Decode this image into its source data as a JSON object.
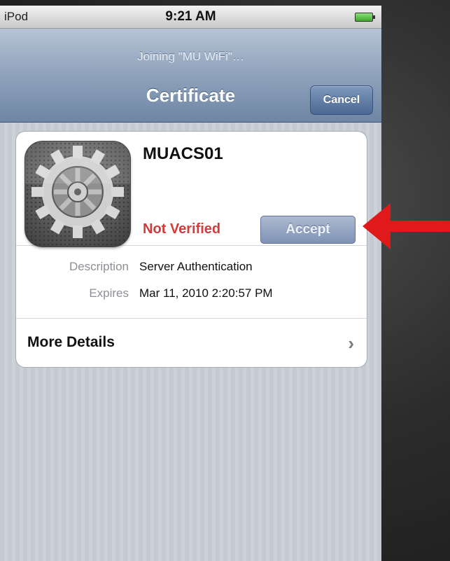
{
  "status_bar": {
    "carrier": "iPod",
    "time": "9:21 AM"
  },
  "nav": {
    "prompt": "Joining \"MU WiFi\"…",
    "title": "Certificate",
    "cancel_label": "Cancel"
  },
  "certificate": {
    "name": "MUACS01",
    "status": "Not Verified",
    "accept_label": "Accept",
    "details": [
      {
        "label": "Description",
        "value": "Server Authentication"
      },
      {
        "label": "Expires",
        "value": "Mar 11, 2010 2:20:57 PM"
      }
    ],
    "more_details_label": "More Details"
  },
  "icons": {
    "cert_icon": "settings-gear-icon",
    "chevron": "chevron-right-icon",
    "battery": "battery-charging-icon",
    "annotation": "red-arrow-icon"
  },
  "colors": {
    "status_red": "#d23b3b",
    "nav_blue": "#6e86a4",
    "arrow_red": "#e01a1a"
  }
}
